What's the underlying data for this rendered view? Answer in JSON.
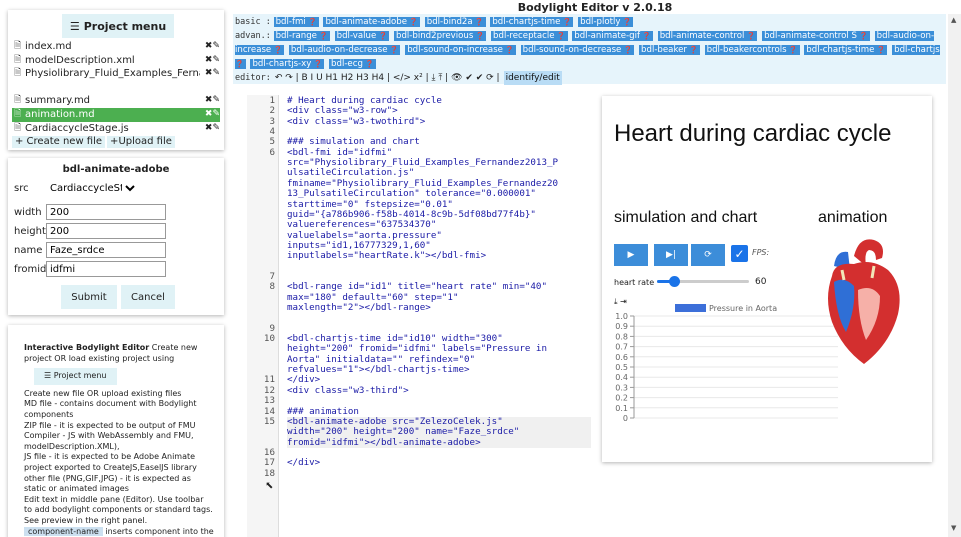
{
  "app": {
    "title": "Bodylight Editor v 2.0.18"
  },
  "files": {
    "menu_label": "Project menu",
    "items": [
      {
        "name": "index.md",
        "active": false
      },
      {
        "name": "modelDescription.xml",
        "active": false
      },
      {
        "name": "Physiolibrary_Fluid_Examples_Fernandez2013_PulsatileCirculation.js",
        "active": false
      },
      {
        "name": "summary.md",
        "active": false
      },
      {
        "name": "animation.md",
        "active": true
      },
      {
        "name": "CardiaccycleStage.js",
        "active": false
      }
    ],
    "new_label": "+ Create new file",
    "upload_label": "Upload file"
  },
  "form": {
    "title": "bdl-animate-adobe",
    "src_label": "src",
    "src_value": "CardiaccycleStag",
    "width_label": "width",
    "width_value": "200",
    "height_label": "height",
    "height_value": "200",
    "name_label": "name",
    "name_value": "Faze_srdce",
    "fromid_label": "fromid",
    "fromid_value": "idfmi",
    "submit_label": "Submit",
    "cancel_label": "Cancel"
  },
  "help": {
    "intro_title": "Interactive Bodylight Editor",
    "intro_rest": " Create new project OR load existing project using",
    "pm_label": "Project menu",
    "lines": [
      "Create new file OR upload existing files",
      "MD file - contains document with Bodylight components",
      "ZIP file - it is expected to be output of FMU Compiler - JS with WebAssembly and FMU, modelDescription.XML),",
      "JS file - it is expected to be Adobe Animate project exported to CreateJS,EaselJS library",
      "other file (PNG,GIF,JPG) - it is expected as static or animated images",
      "Edit text in middle pane (Editor). Use toolbar to add bodylight components or standard tags. See preview in the right panel."
    ],
    "comp_tag": "component-name",
    "comp_text": " inserts component into the"
  },
  "toolbar": {
    "basic_label": "basic :",
    "basic": [
      "bdl-fmi",
      "bdl-animate-adobe",
      "bdl-bind2a",
      "bdl-chartjs-time",
      "bdl-plotly"
    ],
    "adv_label": "advan.:",
    "advanced": [
      "bdl-range",
      "bdl-value",
      "bdl-bind2previous",
      "bdl-receptacle",
      "bdl-animate-gif",
      "bdl-animate-control",
      "bdl-animate-control S",
      "bdl-audio-on-increase",
      "bdl-audio-on-decrease",
      "bdl-sound-on-increase",
      "bdl-sound-on-decrease",
      "bdl-beaker",
      "bdl-beakercontrols",
      "bdl-chartjs-time",
      "bdl-chartjs",
      "bdl-chartjs-xy",
      "bdl-ecg"
    ],
    "editor_label": "editor:",
    "editor_tools": "↶ ↷ | B I U H1 H2 H3 H4 | </> x² | ⤓ ⤒ | 👁 ✔ ✔ ⟳ |",
    "identify_label": "identify/edit"
  },
  "editor": {
    "lines": [
      {
        "n": "1",
        "t": "# Heart during cardiac cycle"
      },
      {
        "n": "2",
        "t": "<div class=\"w3-row\">"
      },
      {
        "n": "3",
        "t": "<div class=\"w3-twothird\">"
      },
      {
        "n": "4",
        "t": ""
      },
      {
        "n": "5",
        "t": "### simulation and chart"
      },
      {
        "n": "6",
        "t": "<bdl-fmi id=\"idfmi\""
      },
      {
        "n": "",
        "t": "src=\"Physiolibrary_Fluid_Examples_Fernandez2013_P"
      },
      {
        "n": "",
        "t": "ulsatileCirculation.js\""
      },
      {
        "n": "",
        "t": "fminame=\"Physiolibrary_Fluid_Examples_Fernandez20"
      },
      {
        "n": "",
        "t": "13_PulsatileCirculation\" tolerance=\"0.000001\""
      },
      {
        "n": "",
        "t": "starttime=\"0\" fstepsize=\"0.01\""
      },
      {
        "n": "",
        "t": "guid=\"{a786b906-f58b-4014-8c9b-5df08bd77f4b}\""
      },
      {
        "n": "",
        "t": "valuereferences=\"637534370\""
      },
      {
        "n": "",
        "t": "valuelabels=\"aorta.pressure\""
      },
      {
        "n": "",
        "t": "inputs=\"id1,16777329,1,60\""
      },
      {
        "n": "",
        "t": "inputlabels=\"heartRate.k\"></bdl-fmi>"
      },
      {
        "n": "",
        "t": ""
      },
      {
        "n": "7",
        "t": ""
      },
      {
        "n": "8",
        "t": "<bdl-range id=\"id1\" title=\"heart rate\" min=\"40\""
      },
      {
        "n": "",
        "t": "max=\"180\" default=\"60\" step=\"1\""
      },
      {
        "n": "",
        "t": "maxlength=\"2\"></bdl-range>"
      },
      {
        "n": "",
        "t": ""
      },
      {
        "n": "9",
        "t": ""
      },
      {
        "n": "10",
        "t": "<bdl-chartjs-time id=\"id10\" width=\"300\""
      },
      {
        "n": "",
        "t": "height=\"200\" fromid=\"idfmi\" labels=\"Pressure in"
      },
      {
        "n": "",
        "t": "Aorta\" initialdata=\"\" refindex=\"0\""
      },
      {
        "n": "",
        "t": "refvalues=\"1\"></bdl-chartjs-time>"
      },
      {
        "n": "11",
        "t": "</div>"
      },
      {
        "n": "12",
        "t": "<div class=\"w3-third\">"
      },
      {
        "n": "13",
        "t": ""
      },
      {
        "n": "14",
        "t": "### animation"
      },
      {
        "n": "15",
        "t": "<bdl-animate-adobe src=\"ZelezoCelek.js\""
      },
      {
        "n": "",
        "t": "width=\"200\" height=\"200\" name=\"Faze_srdce\""
      },
      {
        "n": "",
        "t": "fromid=\"idfmi\"></bdl-animate-adobe>"
      },
      {
        "n": "16",
        "t": ""
      },
      {
        "n": "17",
        "t": "</div>"
      },
      {
        "n": "18",
        "t": ""
      }
    ]
  },
  "preview": {
    "heading": "Heart during cardiac cycle",
    "sub1": "simulation and chart",
    "sub2": "animation",
    "fps_label": "FPS:",
    "range_label": "heart rate",
    "range_value": "60",
    "range_fraction": 0.15,
    "colors": {
      "accent": "#3c8dd9",
      "active_file": "#4caf50",
      "chip": "#3b8fd8",
      "heart_red": "#d32f2f",
      "heart_blue": "#2f6fd6"
    }
  },
  "chart_data": {
    "type": "line",
    "series": [
      {
        "name": "Pressure in Aorta",
        "values": []
      }
    ],
    "y_ticks": [
      "1.0",
      "0.9",
      "0.8",
      "0.7",
      "0.6",
      "0.5",
      "0.4",
      "0.3",
      "0.2",
      "0.1",
      "0"
    ],
    "ylim": [
      0,
      1
    ],
    "legend": "top",
    "grid": true
  }
}
